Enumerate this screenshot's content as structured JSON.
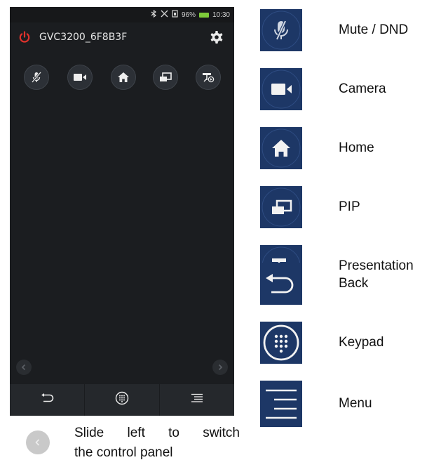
{
  "phone": {
    "status_bar": {
      "battery_percent": "96%",
      "time": "10:30",
      "icons": [
        "bluetooth-icon",
        "no-signal-icon",
        "sim-icon",
        "battery-icon"
      ]
    },
    "header": {
      "device_name": "GVC3200_6F8B3F",
      "icons": [
        "power-icon",
        "settings-gear-icon"
      ]
    },
    "controls": [
      "mute-mic-icon",
      "camera-icon",
      "home-icon",
      "pip-icon",
      "presentation-icon"
    ],
    "nav_arrows": [
      "chevron-left-icon",
      "chevron-right-icon"
    ],
    "bottom_bar": [
      "back-icon",
      "keypad-icon",
      "menu-icon"
    ]
  },
  "hint": {
    "line1": "Slide left to switch",
    "line2": "the control panel"
  },
  "legend": [
    {
      "label": "Mute / DND",
      "icon": "mute-mic-icon"
    },
    {
      "label": "Camera",
      "icon": "camera-icon"
    },
    {
      "label": "Home",
      "icon": "home-icon"
    },
    {
      "label": "PIP",
      "icon": "pip-icon"
    },
    {
      "label": "Presentation",
      "icon": "presentation-icon"
    },
    {
      "label": "Back",
      "icon": "back-icon"
    },
    {
      "label": "Keypad",
      "icon": "keypad-icon"
    },
    {
      "label": "Menu",
      "icon": "menu-icon"
    }
  ],
  "colors": {
    "phone_bg": "#1b1d20",
    "power_red": "#e0322c",
    "legend_bg": "#1d3766",
    "battery_green": "#7ecb3a"
  }
}
